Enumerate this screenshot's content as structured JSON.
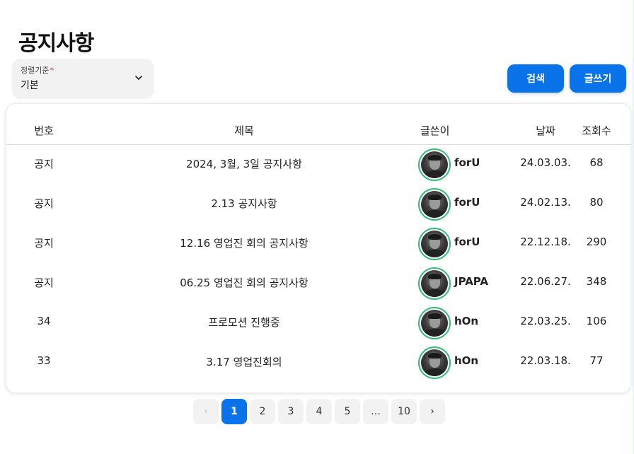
{
  "page": {
    "title": "공지사항"
  },
  "sort": {
    "label": "정렬기준",
    "required_mark": "*",
    "value": "기본"
  },
  "actions": {
    "search_label": "검색",
    "write_label": "글쓰기"
  },
  "colors": {
    "accent": "#0a73ea",
    "avatar_ring": "#2fbf71",
    "required": "#e0245e"
  },
  "table": {
    "columns": {
      "no": "번호",
      "title": "제목",
      "author": "글쓴이",
      "date": "날짜",
      "views": "조회수"
    },
    "rows": [
      {
        "no": "공지",
        "title": "2024, 3월, 3일 공지사항",
        "author": "forU",
        "date": "24.03.03.",
        "views": "68"
      },
      {
        "no": "공지",
        "title": "2.13 공지사항",
        "author": "forU",
        "date": "24.02.13.",
        "views": "80"
      },
      {
        "no": "공지",
        "title": "12.16 영업진 회의 공지사항",
        "author": "forU",
        "date": "22.12.18.",
        "views": "290"
      },
      {
        "no": "공지",
        "title": "06.25 영업진 회의 공지사항",
        "author": "JPAPA",
        "date": "22.06.27.",
        "views": "348"
      },
      {
        "no": "34",
        "title": "프로모션 진행중",
        "author": "hOn",
        "date": "22.03.25.",
        "views": "106"
      },
      {
        "no": "33",
        "title": "3.17 영업진회의",
        "author": "hOn",
        "date": "22.03.18.",
        "views": "77"
      }
    ]
  },
  "pagination": {
    "prev": "‹",
    "next": "›",
    "pages": [
      "1",
      "2",
      "3",
      "4",
      "5",
      "…",
      "10"
    ],
    "current": "1"
  }
}
